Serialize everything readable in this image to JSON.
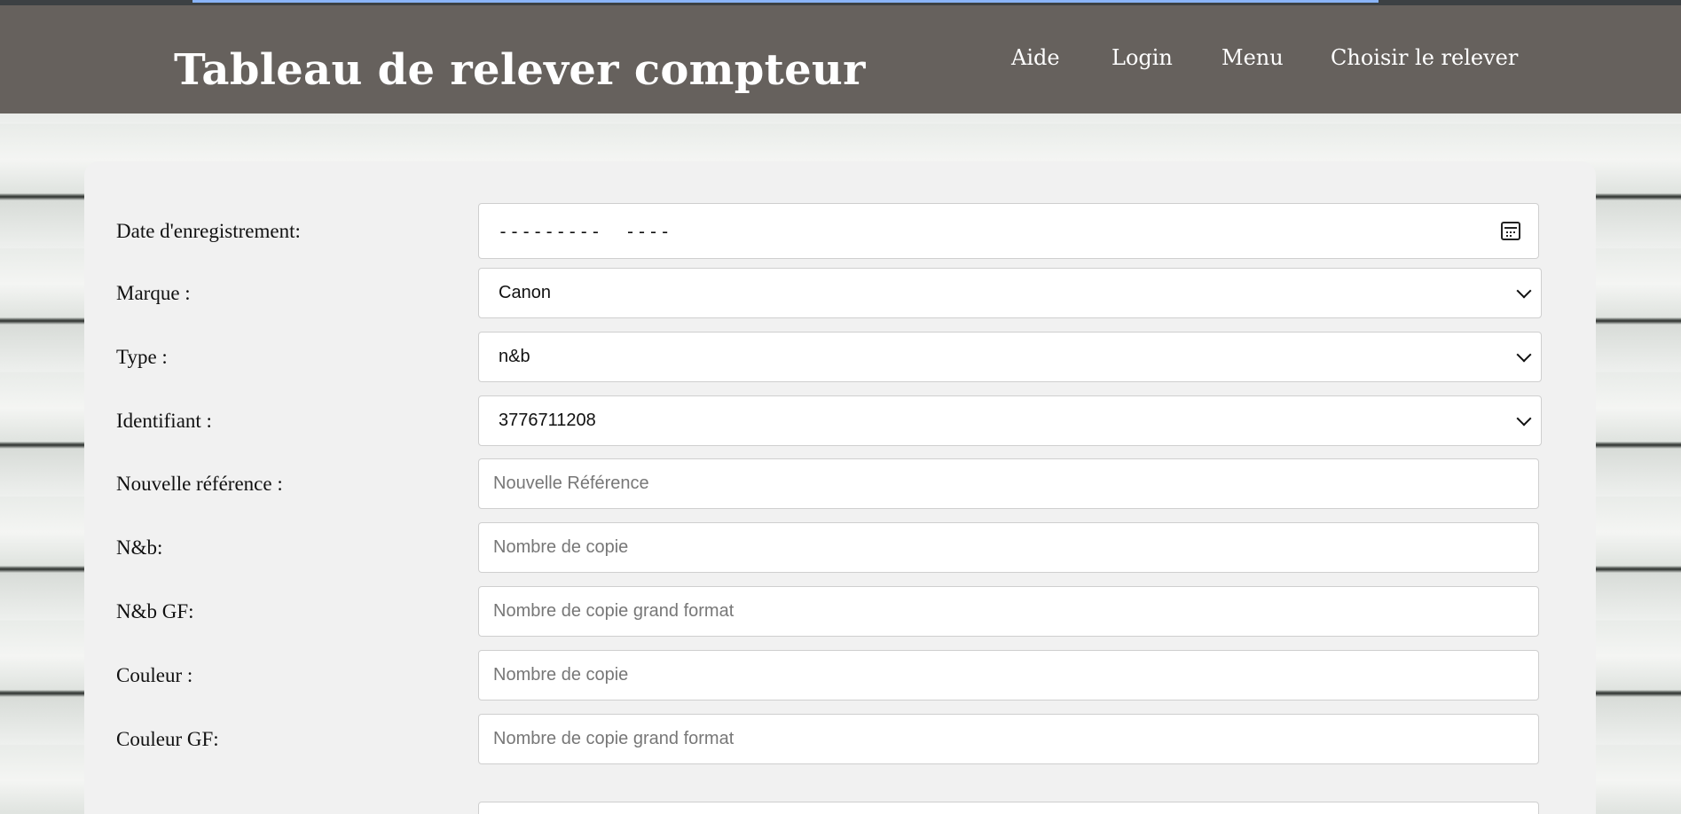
{
  "header": {
    "title": "Tableau de relever compteur",
    "nav": {
      "aide": "Aide",
      "login": "Login",
      "menu": "Menu",
      "choisir": "Choisir le relever"
    }
  },
  "form": {
    "date": {
      "label": "Date d'enregistrement:",
      "mask": "---------  ----"
    },
    "marque": {
      "label": "Marque :",
      "value": "Canon"
    },
    "type": {
      "label": "Type :",
      "value": "n&b"
    },
    "identifiant": {
      "label": "Identifiant :",
      "value": "3776711208"
    },
    "nouvelle_reference": {
      "label": "Nouvelle référence :",
      "placeholder": "Nouvelle Référence"
    },
    "nb": {
      "label": "N&b:",
      "placeholder": "Nombre de copie"
    },
    "nb_gf": {
      "label": "N&b GF:",
      "placeholder": "Nombre de copie grand format"
    },
    "couleur": {
      "label": "Couleur :",
      "placeholder": "Nombre de copie"
    },
    "couleur_gf": {
      "label": "Couleur GF:",
      "placeholder": "Nombre de copie grand format"
    }
  },
  "colors": {
    "navbar_bg": "#66615d",
    "panel_bg": "#f1f1f1"
  }
}
